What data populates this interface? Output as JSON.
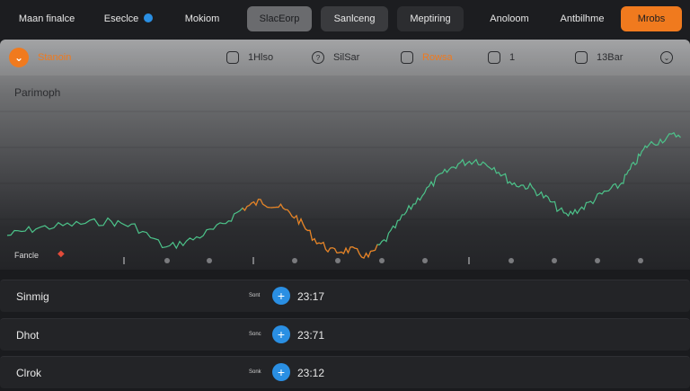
{
  "topbar": {
    "items": [
      {
        "label": "Maan finalce"
      },
      {
        "label": "Eseclce"
      },
      {
        "label": "Mokiom"
      },
      {
        "label": "SlacEorp"
      },
      {
        "label": "Sanlceng"
      },
      {
        "label": "Meptiring"
      },
      {
        "label": "Anoloom"
      },
      {
        "label": "Antbilhme"
      },
      {
        "label": "Mrobs"
      }
    ]
  },
  "panel": {
    "badge_label": "Stanoin",
    "title": "Parimoph",
    "stats": [
      {
        "icon": "square-icon",
        "value": "1Hlso"
      },
      {
        "icon": "info-icon",
        "value": "SilSar"
      },
      {
        "icon": "square-icon",
        "value": "Rowsa"
      },
      {
        "icon": "square-icon",
        "value": "1"
      },
      {
        "icon": "square-icon",
        "value": "13Bar"
      },
      {
        "icon": "chevron-down-icon",
        "value": ""
      }
    ],
    "footer_label": "Fancle",
    "colors": {
      "accent": "#f07a1e",
      "line": "#4cc38a",
      "blue": "#2a8fe3"
    }
  },
  "rows": [
    {
      "name": "Sinmig",
      "small": "Sont",
      "time": "23:17"
    },
    {
      "name": "Dhot",
      "small": "Sonc",
      "time": "23:71"
    },
    {
      "name": "Clrok",
      "small": "Sonk",
      "time": "23:12"
    }
  ]
}
